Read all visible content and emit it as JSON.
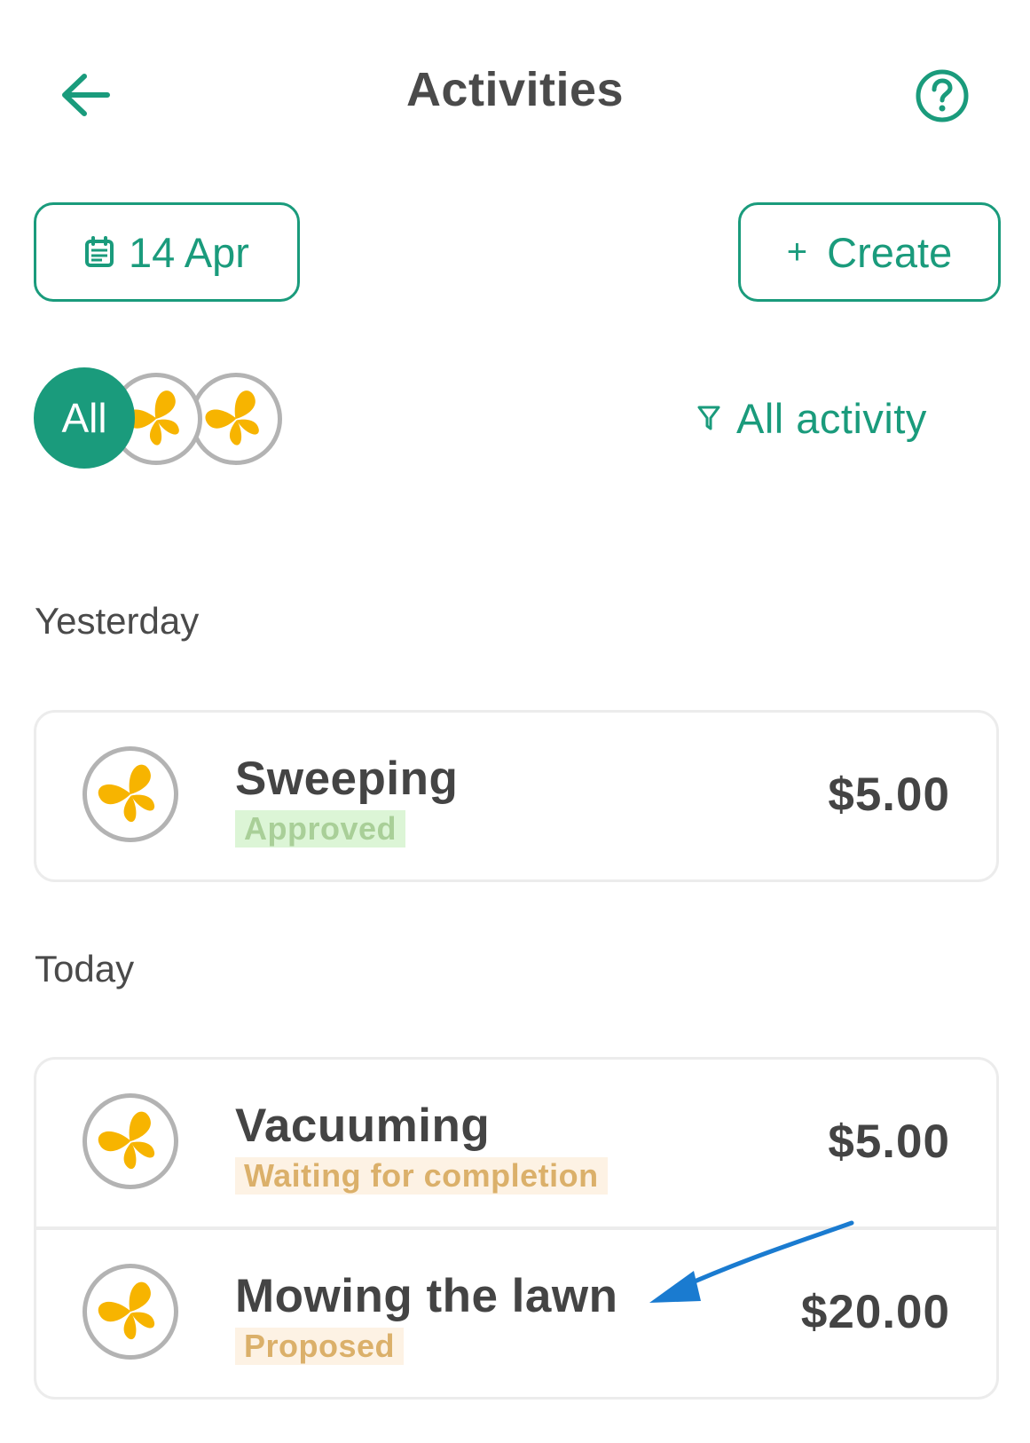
{
  "header": {
    "title": "Activities",
    "back_icon": "arrow-left-icon",
    "help_icon": "question-circle-icon"
  },
  "toolbar": {
    "date_label": "14 Apr",
    "create_plus": "+",
    "create_label": "Create"
  },
  "filters": {
    "all_label": "All",
    "filter_label": "All activity",
    "filter_icon": "funnel-icon"
  },
  "sections": [
    {
      "label": "Yesterday",
      "items": [
        {
          "name": "Sweeping",
          "status": "Approved",
          "amount": "$5.00"
        }
      ]
    },
    {
      "label": "Today",
      "items": [
        {
          "name": "Vacuuming",
          "status": "Waiting for completion",
          "amount": "$5.00"
        },
        {
          "name": "Mowing the lawn",
          "status": "Proposed",
          "amount": "$20.00"
        }
      ]
    }
  ],
  "colors": {
    "accent": "#1a9b7c",
    "butterfly": "#f7b400",
    "approved_bg": "#dcf5d6",
    "approved_text": "#a9cf98",
    "pending_bg": "#fdf2e4",
    "pending_text": "#dbb06a",
    "annotation_arrow": "#1a7bd0"
  }
}
